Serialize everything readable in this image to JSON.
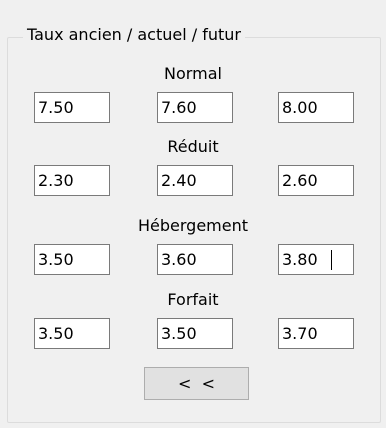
{
  "group": {
    "title": "Taux ancien / actuel / futur"
  },
  "sections": {
    "normal": {
      "label": "Normal",
      "ancien": "7.50",
      "actuel": "7.60",
      "futur": "8.00"
    },
    "reduit": {
      "label": "Réduit",
      "ancien": "2.30",
      "actuel": "2.40",
      "futur": "2.60"
    },
    "hebergement": {
      "label": "Hébergement",
      "ancien": "3.50",
      "actuel": "3.60",
      "futur": "3.80"
    },
    "forfait": {
      "label": "Forfait",
      "ancien": "3.50",
      "actuel": "3.50",
      "futur": "3.70"
    }
  },
  "button": {
    "label": "<  <"
  }
}
